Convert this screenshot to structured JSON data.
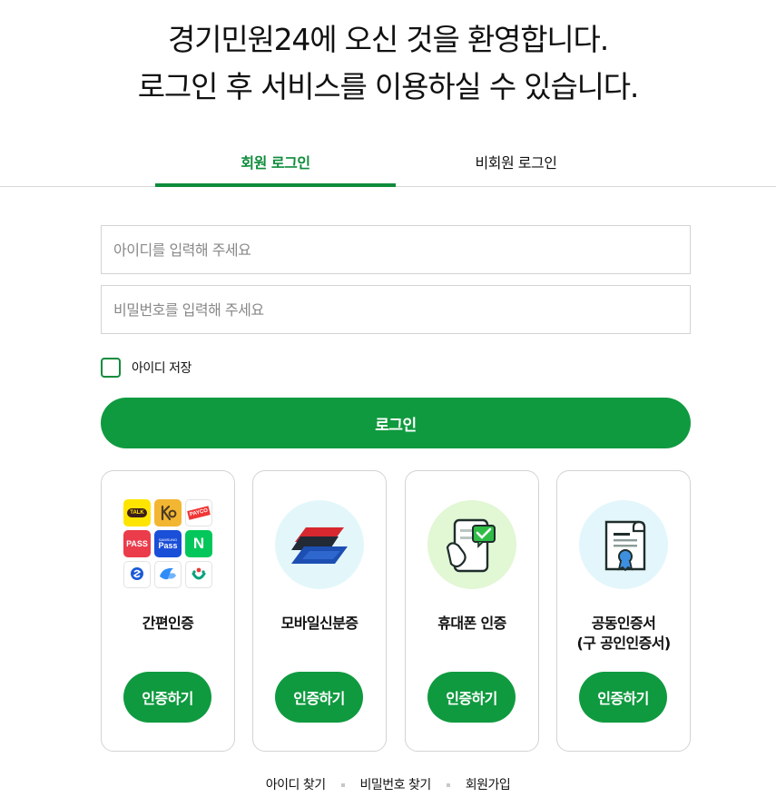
{
  "welcome": {
    "line1": "경기민원24에 오신 것을 환영합니다.",
    "line2": "로그인 후 서비스를 이용하실 수 있습니다."
  },
  "tabs": {
    "member": "회원 로그인",
    "guest": "비회원 로그인",
    "active": "member"
  },
  "form": {
    "id_placeholder": "아이디를 입력해 주세요",
    "pw_placeholder": "비밀번호를 입력해 주세요",
    "remember_label": "아이디 저장",
    "login_button": "로그인"
  },
  "auth_options": [
    {
      "title": "간편인증",
      "button": "인증하기",
      "icon": "easy-auth-app-grid-icon"
    },
    {
      "title": "모바일신분증",
      "button": "인증하기",
      "icon": "mobile-id-card-icon"
    },
    {
      "title": "휴대폰 인증",
      "button": "인증하기",
      "icon": "phone-verified-icon"
    },
    {
      "title_line1": "공동인증서",
      "title_line2": "(구 공인인증서)",
      "button": "인증하기",
      "icon": "certificate-scroll-icon"
    }
  ],
  "easy_auth_apps": {
    "kakao": "TALK",
    "pass": "PASS",
    "samsung_top": "SAMSUNG",
    "samsung_bottom": "Pass",
    "naver": "N",
    "payco": "PAYCO"
  },
  "footer_links": {
    "find_id": "아이디 찾기",
    "find_pw": "비밀번호 찾기",
    "signup": "회원가입"
  },
  "colors": {
    "primary_green": "#0f9a3f",
    "tab_active_green": "#0f8c3b",
    "mobile_id_bg": "#e3f7fb",
    "phone_bg": "#e2f7d4",
    "cert_bg": "#e3f6fb"
  }
}
